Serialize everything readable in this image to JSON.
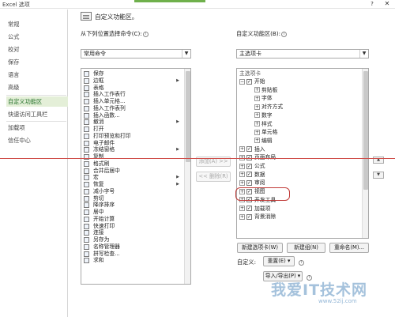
{
  "window": {
    "title": "Excel 选项",
    "help": "?",
    "close": "✕"
  },
  "nav": {
    "items": [
      "常规",
      "公式",
      "校对",
      "保存",
      "语言",
      "高级",
      "自定义功能区",
      "快速访问工具栏",
      "加载项",
      "信任中心"
    ],
    "active_index": 6
  },
  "header": {
    "text": "自定义功能区。"
  },
  "left_panel": {
    "label": "从下列位置选择命令(C):",
    "dropdown_value": "常用命令",
    "commands": [
      {
        "label": "保存",
        "icon": "save-icon"
      },
      {
        "label": "边框",
        "icon": "border-icon",
        "submenu": true
      },
      {
        "label": "表格",
        "icon": "table-icon"
      },
      {
        "label": "插入工作表行",
        "icon": "insert-row-icon"
      },
      {
        "label": "插入单元格...",
        "icon": "insert-cells-icon"
      },
      {
        "label": "插入工作表列",
        "icon": "insert-column-icon"
      },
      {
        "label": "插入函数...",
        "icon": "function-icon"
      },
      {
        "label": "撤消",
        "icon": "undo-icon",
        "submenu": true
      },
      {
        "label": "打开",
        "icon": "open-icon"
      },
      {
        "label": "打印预览和打印",
        "icon": "print-preview-icon"
      },
      {
        "label": "电子邮件",
        "icon": "email-icon"
      },
      {
        "label": "冻结窗格",
        "icon": "freeze-panes-icon",
        "submenu": true
      },
      {
        "label": "复制",
        "icon": "copy-icon"
      },
      {
        "label": "格式刷",
        "icon": "format-painter-icon"
      },
      {
        "label": "合并后居中",
        "icon": "merge-center-icon"
      },
      {
        "label": "宏",
        "icon": "macro-icon",
        "submenu": true
      },
      {
        "label": "恢复",
        "icon": "redo-icon",
        "submenu": true
      },
      {
        "label": "减小字号",
        "icon": "decrease-font-icon"
      },
      {
        "label": "剪切",
        "icon": "cut-icon"
      },
      {
        "label": "降序排序",
        "icon": "sort-desc-icon"
      },
      {
        "label": "居中",
        "icon": "center-icon"
      },
      {
        "label": "开始计算",
        "icon": "calculate-icon"
      },
      {
        "label": "快速打印",
        "icon": "quick-print-icon"
      },
      {
        "label": "连接",
        "icon": "connection-icon"
      },
      {
        "label": "另存为",
        "icon": "save-as-icon"
      },
      {
        "label": "名称管理器",
        "icon": "name-manager-icon"
      },
      {
        "label": "拼写检查...",
        "icon": "spelling-icon"
      },
      {
        "label": "求和",
        "icon": "sum-icon"
      }
    ]
  },
  "middle": {
    "add_label": "添加(A) >>",
    "remove_label": "<< 删除(R)"
  },
  "right_panel": {
    "label": "自定义功能区(B):",
    "dropdown_value": "主选项卡",
    "tree_header": "主选项卡",
    "tree": [
      {
        "label": "开始",
        "level": 0,
        "expander": "⊟",
        "checked": true
      },
      {
        "label": "剪贴板",
        "level": 1,
        "expander": "⊞"
      },
      {
        "label": "字体",
        "level": 1,
        "expander": "⊞"
      },
      {
        "label": "对齐方式",
        "level": 1,
        "expander": "⊞"
      },
      {
        "label": "数字",
        "level": 1,
        "expander": "⊞"
      },
      {
        "label": "样式",
        "level": 1,
        "expander": "⊞"
      },
      {
        "label": "单元格",
        "level": 1,
        "expander": "⊞"
      },
      {
        "label": "编辑",
        "level": 1,
        "expander": "⊞"
      },
      {
        "label": "插入",
        "level": 0,
        "expander": "⊞",
        "checked": true
      },
      {
        "label": "页面布局",
        "level": 0,
        "expander": "⊞",
        "checked": true
      },
      {
        "label": "公式",
        "level": 0,
        "expander": "⊞",
        "checked": true
      },
      {
        "label": "数据",
        "level": 0,
        "expander": "⊞",
        "checked": true
      },
      {
        "label": "审阅",
        "level": 0,
        "expander": "⊞",
        "checked": true
      },
      {
        "label": "视图",
        "level": 0,
        "expander": "⊞",
        "checked": true
      },
      {
        "label": "开发工具",
        "level": 0,
        "expander": "⊞",
        "checked": true
      },
      {
        "label": "加载项",
        "level": 0,
        "expander": "⊞",
        "checked": true
      },
      {
        "label": "背景消除",
        "level": 0,
        "expander": "⊞",
        "checked": true
      }
    ],
    "new_tab_label": "新建选项卡(W)",
    "new_group_label": "新建组(N)",
    "rename_label": "重命名(M)...",
    "customize_label": "自定义:",
    "reset_label": "重置(E) ▾",
    "import_export_label": "导入/导出(P) ▾"
  },
  "watermark": {
    "main": "我爱IT技术网",
    "sub": "www.52ij.com"
  },
  "colors": {
    "accent_green": "#1f6e25",
    "active_bg": "#e4efd8",
    "highlight_red": "#c03a37",
    "red_line": "#d0504c"
  }
}
